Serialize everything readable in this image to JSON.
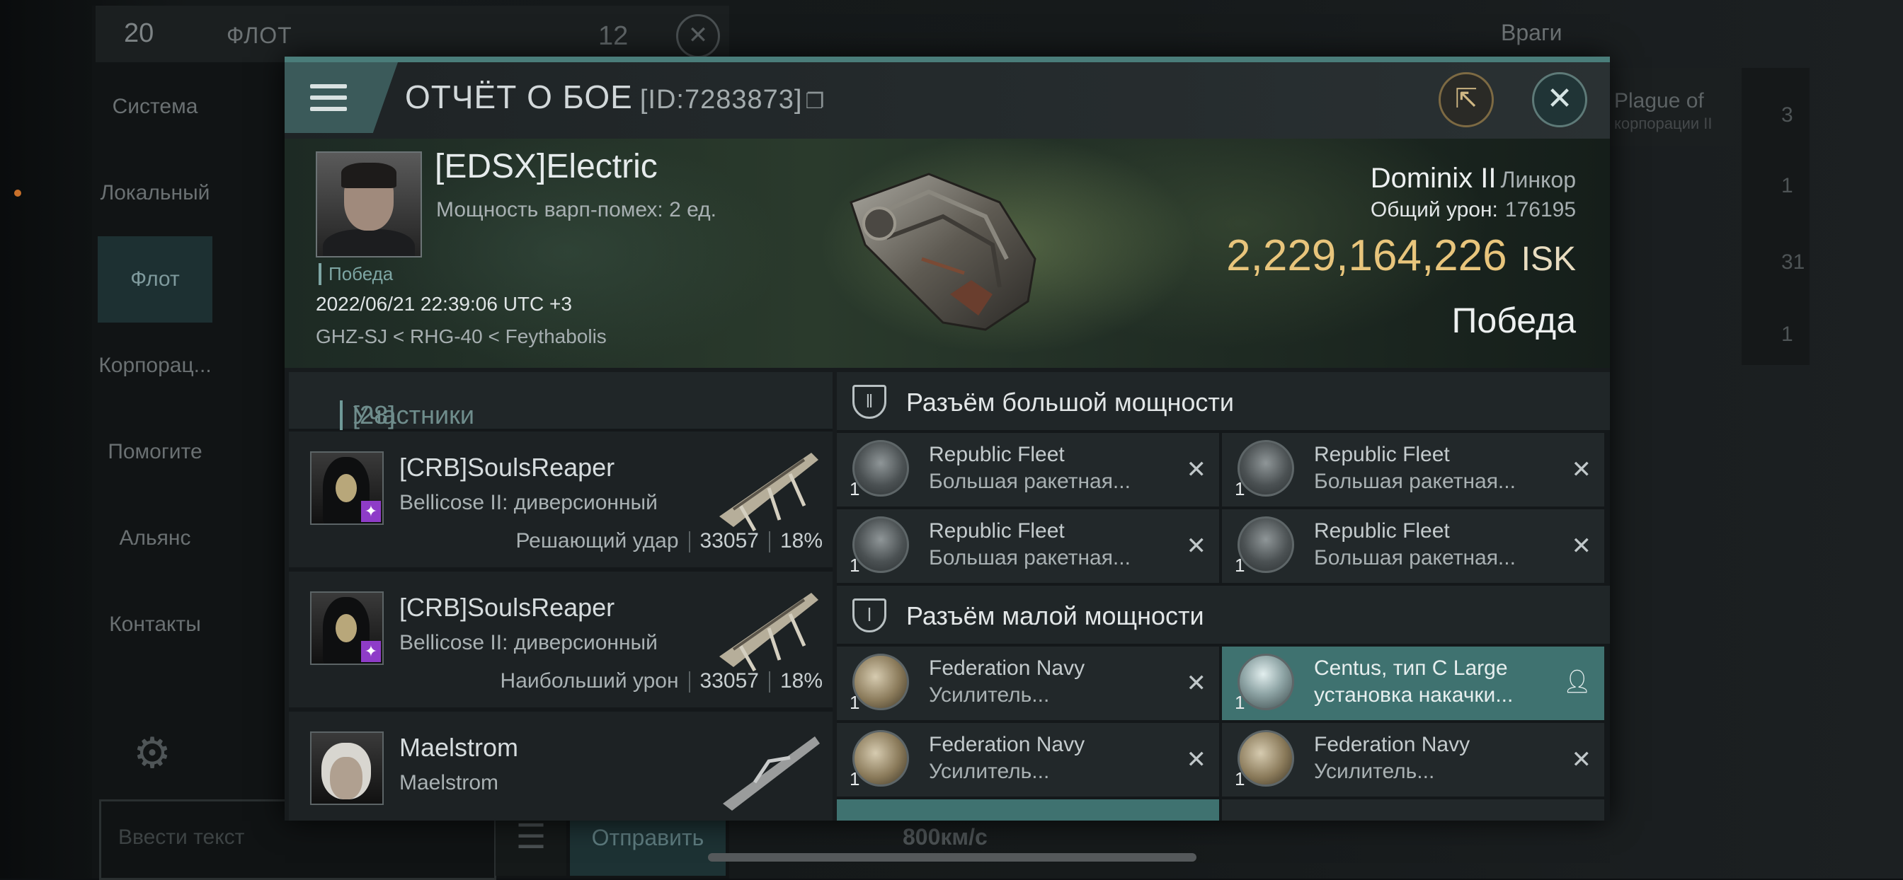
{
  "background": {
    "chat_count": "20",
    "chat_title": "ФЛОТ",
    "chat_count2": "12",
    "tabs": [
      {
        "label": "Система",
        "active": false
      },
      {
        "label": "Локальный",
        "active": false
      },
      {
        "label": "Флот",
        "active": true
      },
      {
        "label": "Корпорац...",
        "active": false
      },
      {
        "label": "Помогите",
        "active": false
      },
      {
        "label": "Альянс",
        "active": false
      },
      {
        "label": "Контакты",
        "active": false
      }
    ],
    "input_placeholder": "Ввести текст",
    "send_label": "Отправить",
    "speed": "800км/с",
    "enemy_filter": "Враги",
    "plague_line1": "Plague of",
    "plague_line2": "корпорации II",
    "side_counts": [
      "3",
      "1",
      "31",
      "1"
    ]
  },
  "report": {
    "title": "ОТЧЁТ О БОЕ",
    "report_id": "[ID:7283873]",
    "pilot_name": "[EDSX]Electric",
    "warp_power": "Мощность варп-помех: 2 ед.",
    "outcome_tag": "Победа",
    "datetime": "2022/06/21 22:39:06 UTC +3",
    "route": "GHZ-SJ < RHG-40 < Feythabolis",
    "ship_name": "Dominix II",
    "ship_class": "Линкор",
    "total_damage_label": "Общий урон:",
    "total_damage_value": "176195",
    "isk_value": "2,229,164,226",
    "isk_unit": "ISK",
    "result": "Победа"
  },
  "participants": {
    "header": "Участники",
    "count": "[28]",
    "rows": [
      {
        "name": "[CRB]SoulsReaper",
        "ship": "Bellicose II: диверсионный",
        "role": "Решающий удар",
        "damage": "33057",
        "percent": "18%"
      },
      {
        "name": "[CRB]SoulsReaper",
        "ship": "Bellicose II: диверсионный",
        "role": "Наибольший урон",
        "damage": "33057",
        "percent": "18%"
      },
      {
        "name": "Maelstrom",
        "ship": "Maelstrom",
        "role": "",
        "damage": "",
        "percent": ""
      }
    ]
  },
  "slots": {
    "high_title": "Разъём большой мощности",
    "low_title": "Разъём малой мощности",
    "high": [
      {
        "line1": "Republic Fleet",
        "line2": "Большая ракетная...",
        "qty": "1"
      },
      {
        "line1": "Republic Fleet",
        "line2": "Большая ракетная...",
        "qty": "1"
      },
      {
        "line1": "Republic Fleet",
        "line2": "Большая ракетная...",
        "qty": "1"
      },
      {
        "line1": "Republic Fleet",
        "line2": "Большая ракетная...",
        "qty": "1"
      }
    ],
    "low": [
      {
        "line1": "Federation Navy",
        "line2": "Усилитель...",
        "qty": "1"
      },
      {
        "line1": "Centus, тип C Large",
        "line2": "установка накачки...",
        "qty": "1"
      },
      {
        "line1": "Federation Navy",
        "line2": "Усилитель...",
        "qty": "1"
      },
      {
        "line1": "Federation Navy",
        "line2": "Усилитель...",
        "qty": "1"
      }
    ]
  },
  "colors": {
    "accent": "#3f7270",
    "isk": "#e8c57c"
  }
}
